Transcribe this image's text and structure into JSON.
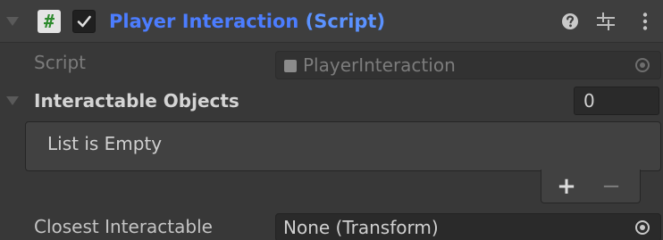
{
  "component": {
    "script_icon_glyph": "#",
    "enabled": true,
    "title_main": "Player Interaction",
    "title_tail": " (Script)",
    "icons": [
      "help-icon",
      "presets-icon",
      "kebab-menu-icon"
    ]
  },
  "fields": {
    "script_label": "Script",
    "script_value": "PlayerInteraction",
    "list_label": "Interactable Objects",
    "list_size": "0",
    "list_empty_text": "List is Empty",
    "add_glyph": "+",
    "remove_glyph": "−",
    "closest_label": "Closest Interactable",
    "closest_value": "None (Transform)"
  },
  "colors": {
    "background": "#383838",
    "header": "#3e3e3e",
    "title": "#4c7dff",
    "field": "#2a2a2a"
  }
}
